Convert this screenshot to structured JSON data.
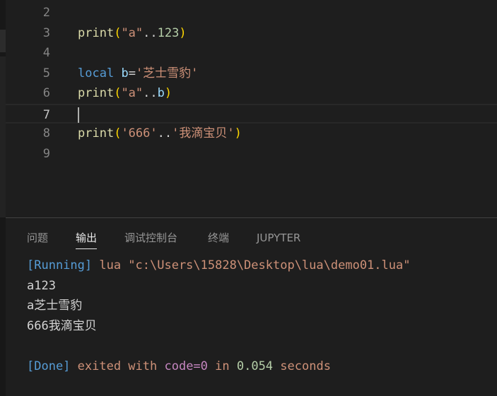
{
  "editor": {
    "lines": [
      {
        "num": "2",
        "tokens": []
      },
      {
        "num": "3",
        "tokens": [
          [
            "fn",
            "print"
          ],
          [
            "br1",
            "("
          ],
          [
            "str",
            "\"a\""
          ],
          [
            "op",
            ".."
          ],
          [
            "num",
            "123"
          ],
          [
            "br1",
            ")"
          ]
        ]
      },
      {
        "num": "4",
        "tokens": []
      },
      {
        "num": "5",
        "tokens": [
          [
            "kw",
            "local"
          ],
          [
            "op",
            " "
          ],
          [
            "var",
            "b"
          ],
          [
            "op",
            "="
          ],
          [
            "str",
            "'芝士雪豹'"
          ]
        ]
      },
      {
        "num": "6",
        "tokens": [
          [
            "fn",
            "print"
          ],
          [
            "br1",
            "("
          ],
          [
            "str",
            "\"a\""
          ],
          [
            "op",
            ".."
          ],
          [
            "var",
            "b"
          ],
          [
            "br1",
            ")"
          ]
        ]
      },
      {
        "num": "7",
        "tokens": []
      },
      {
        "num": "8",
        "tokens": [
          [
            "fn",
            "print"
          ],
          [
            "br1",
            "("
          ],
          [
            "str",
            "'666'"
          ],
          [
            "op",
            ".."
          ],
          [
            "str",
            "'我滴宝贝'"
          ],
          [
            "br1",
            ")"
          ]
        ]
      },
      {
        "num": "9",
        "tokens": []
      }
    ],
    "current_line": "7"
  },
  "panel": {
    "tabs": [
      {
        "label": "问题",
        "active": false
      },
      {
        "label": "输出",
        "active": true
      },
      {
        "label": "调试控制台",
        "active": false
      },
      {
        "label": "终端",
        "active": false
      },
      {
        "label": "JUPYTER",
        "active": false
      }
    ],
    "output": {
      "running_tag": "[Running]",
      "running_cmd": " lua \"c:\\Users\\15828\\Desktop\\lua\\demo01.lua\"",
      "lines": [
        "a123",
        "a芝士雪豹",
        "666我滴宝贝"
      ],
      "done_tag": "[Done]",
      "done_exited": " exited with ",
      "done_code": "code=0",
      "done_in": " in ",
      "done_time": "0.054",
      "done_seconds": " seconds"
    }
  },
  "colors": {
    "background": "#1e1e1e",
    "keyword": "#569cd6",
    "function": "#dcdcaa",
    "string": "#ce9178",
    "number": "#b5cea8",
    "variable": "#9cdcfe",
    "bracket": "#ffd700"
  }
}
